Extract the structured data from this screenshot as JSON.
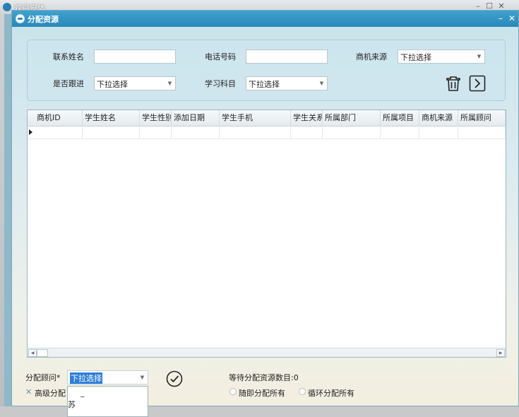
{
  "parent_window": {
    "title": "欢迎窗体"
  },
  "window": {
    "title": "分配资源"
  },
  "filters": {
    "contact_name_label": "联系姓名",
    "contact_name_value": "",
    "phone_label": "电话号码",
    "phone_value": "",
    "source_label": "商机来源",
    "source_value": "下拉选择",
    "follow_label": "是否跟进",
    "follow_value": "下拉选择",
    "subject_label": "学习科目",
    "subject_value": "下拉选择"
  },
  "icons": {
    "delete": "trash-icon",
    "next": "chevron-right-icon",
    "confirm": "check-circle-icon"
  },
  "table": {
    "columns": [
      "商机ID",
      "学生姓名",
      "学生性别",
      "添加日期",
      "学生手机",
      "学生关系",
      "所属部门",
      "所属项目",
      "商机来源",
      "所属顾问"
    ],
    "rows": [
      [
        "",
        "",
        "",
        "",
        "",
        "",
        "",
        "",
        "",
        ""
      ]
    ]
  },
  "bottom": {
    "advisor_label": "分配顾问*",
    "advisor_value": "下拉选择",
    "advanced_label": "高级分配",
    "pending_label": "等待分配资源数目:0",
    "random_label": "随即分配所有",
    "cycle_label": "循环分配所有",
    "dropdown_items": [
      "_",
      "苏"
    ]
  }
}
